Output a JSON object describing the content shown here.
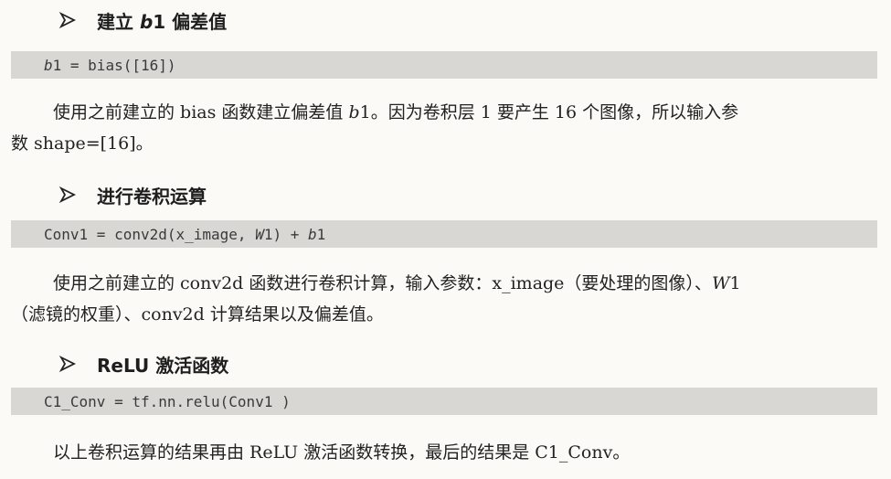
{
  "sections": [
    {
      "heading_icon": "arrow-right-icon",
      "heading_prefix": "建立",
      "heading_var": "b",
      "heading_suffix": "1 偏差值",
      "code": {
        "var": "b",
        "line_rest": "1 = bias([16])"
      },
      "para": {
        "line1_a": "使用之前建立的 bias 函数建立偏差值 ",
        "line1_var": "b",
        "line1_b": "1。因为卷积层 1 要产生 16 个图像，所以输入参",
        "line2": "数 shape=[16]。"
      }
    },
    {
      "heading_icon": "arrow-right-icon",
      "heading_text": "进行卷积运算",
      "code": {
        "part1": "Conv1 = conv2d(x_image, ",
        "var1": "W",
        "part2": "1) + ",
        "var2": "b",
        "part3": "1"
      },
      "para": {
        "line1_a": "使用之前建立的 conv2d 函数进行卷积计算，输入参数：x_image（要处理的图像）、",
        "line1_var": "W",
        "line1_b": "1",
        "line2": "（滤镜的权重）、conv2d 计算结果以及偏差值。"
      }
    },
    {
      "heading_icon": "arrow-right-icon",
      "heading_text": "ReLU 激活函数",
      "code": {
        "line": "C1_Conv = tf.nn.relu(Conv1 )"
      },
      "para": {
        "line1": "以上卷积运算的结果再由 ReLU 激活函数转换，最后的结果是 C1_Conv。"
      }
    }
  ]
}
